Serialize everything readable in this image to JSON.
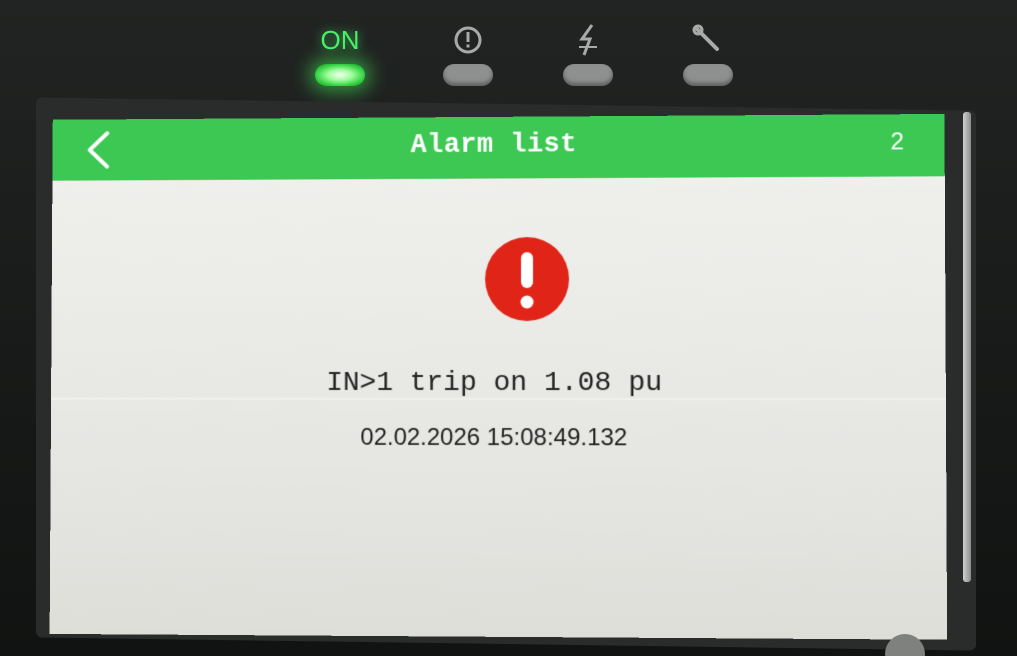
{
  "leds": [
    {
      "name": "on",
      "label": "ON",
      "active": true
    },
    {
      "name": "alarm",
      "icon": "warning-circle-icon",
      "symbol": "ⓘ",
      "active": false
    },
    {
      "name": "trip",
      "icon": "lightning-icon",
      "symbol": "↯",
      "active": false
    },
    {
      "name": "service",
      "icon": "wrench-icon",
      "symbol": "🔧",
      "active": false
    }
  ],
  "screen": {
    "title": "Alarm list",
    "count": "2",
    "back_icon": "chevron-left-icon"
  },
  "alarm": {
    "icon": "exclamation-icon",
    "message": "IN>1 trip on 1.08 pu",
    "timestamp": "02.02.2026  15:08:49.132"
  },
  "colors": {
    "header": "#3dc854",
    "alarm_icon": "#e02418",
    "led_on": "#47f06a",
    "led_off": "#8e908f"
  }
}
